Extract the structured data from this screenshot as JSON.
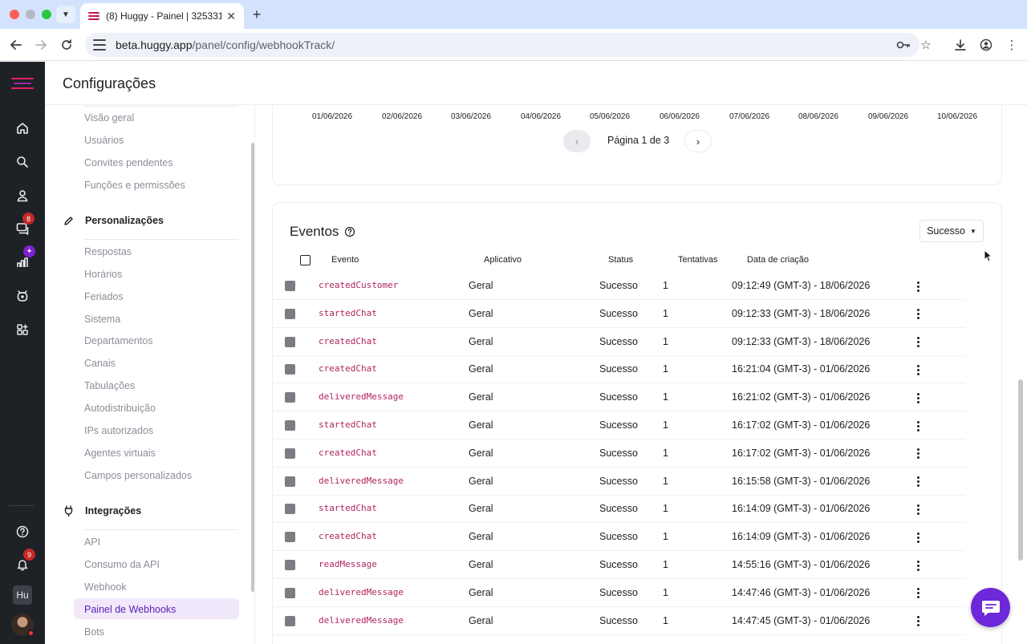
{
  "browser": {
    "tab_title": "(8) Huggy - Painel | 325331",
    "url_host": "beta.huggy.app",
    "url_path": "/panel/config/webhookTrack/"
  },
  "rail": {
    "chat_badge": "8",
    "reports_badge": "✦",
    "notifications_badge": "9",
    "workspace_initials": "Hu",
    "accent_color": "#6d28d9",
    "badge_color": "#c62828"
  },
  "header": {
    "title": "Configurações"
  },
  "settings_menu": {
    "general_items": [
      "Visão geral",
      "Usuários",
      "Convites pendentes",
      "Funções e permissões"
    ],
    "customization_title": "Personalizações",
    "customization_items": [
      "Respostas",
      "Horários",
      "Feriados",
      "Sistema",
      "Departamentos",
      "Canais",
      "Tabulações",
      "Autodistribuição",
      "IPs autorizados",
      "Agentes virtuais",
      "Campos personalizados"
    ],
    "integrations_title": "Integrações",
    "integrations_items": [
      "API",
      "Consumo da API",
      "Webhook",
      "Painel de Webhooks",
      "Bots"
    ],
    "active_item": "Painel de Webhooks"
  },
  "chart": {
    "x_ticks": [
      "01/06/2026",
      "02/06/2026",
      "03/06/2026",
      "04/06/2026",
      "05/06/2026",
      "06/06/2026",
      "07/06/2026",
      "08/06/2026",
      "09/06/2026",
      "10/06/2026"
    ],
    "pager_text": "Página 1 de 3"
  },
  "events": {
    "title": "Eventos",
    "filter_value": "Sucesso",
    "columns": [
      "Evento",
      "Aplicativo",
      "Status",
      "Tentativas",
      "Data de criação"
    ],
    "event_color": "#b0245f",
    "rows": [
      {
        "evento": "createdCustomer",
        "aplicativo": "Geral",
        "status": "Sucesso",
        "tentativas": "1",
        "data": "09:12:49 (GMT-3) - 18/06/2026"
      },
      {
        "evento": "startedChat",
        "aplicativo": "Geral",
        "status": "Sucesso",
        "tentativas": "1",
        "data": "09:12:33 (GMT-3) - 18/06/2026"
      },
      {
        "evento": "createdChat",
        "aplicativo": "Geral",
        "status": "Sucesso",
        "tentativas": "1",
        "data": "09:12:33 (GMT-3) - 18/06/2026"
      },
      {
        "evento": "createdChat",
        "aplicativo": "Geral",
        "status": "Sucesso",
        "tentativas": "1",
        "data": "16:21:04 (GMT-3) - 01/06/2026"
      },
      {
        "evento": "deliveredMessage",
        "aplicativo": "Geral",
        "status": "Sucesso",
        "tentativas": "1",
        "data": "16:21:02 (GMT-3) - 01/06/2026"
      },
      {
        "evento": "startedChat",
        "aplicativo": "Geral",
        "status": "Sucesso",
        "tentativas": "1",
        "data": "16:17:02 (GMT-3) - 01/06/2026"
      },
      {
        "evento": "createdChat",
        "aplicativo": "Geral",
        "status": "Sucesso",
        "tentativas": "1",
        "data": "16:17:02 (GMT-3) - 01/06/2026"
      },
      {
        "evento": "deliveredMessage",
        "aplicativo": "Geral",
        "status": "Sucesso",
        "tentativas": "1",
        "data": "16:15:58 (GMT-3) - 01/06/2026"
      },
      {
        "evento": "startedChat",
        "aplicativo": "Geral",
        "status": "Sucesso",
        "tentativas": "1",
        "data": "16:14:09 (GMT-3) - 01/06/2026"
      },
      {
        "evento": "createdChat",
        "aplicativo": "Geral",
        "status": "Sucesso",
        "tentativas": "1",
        "data": "16:14:09 (GMT-3) - 01/06/2026"
      },
      {
        "evento": "readMessage",
        "aplicativo": "Geral",
        "status": "Sucesso",
        "tentativas": "1",
        "data": "14:55:16 (GMT-3) - 01/06/2026"
      },
      {
        "evento": "deliveredMessage",
        "aplicativo": "Geral",
        "status": "Sucesso",
        "tentativas": "1",
        "data": "14:47:46 (GMT-3) - 01/06/2026"
      },
      {
        "evento": "deliveredMessage",
        "aplicativo": "Geral",
        "status": "Sucesso",
        "tentativas": "1",
        "data": "14:47:45 (GMT-3) - 01/06/2026"
      }
    ]
  }
}
